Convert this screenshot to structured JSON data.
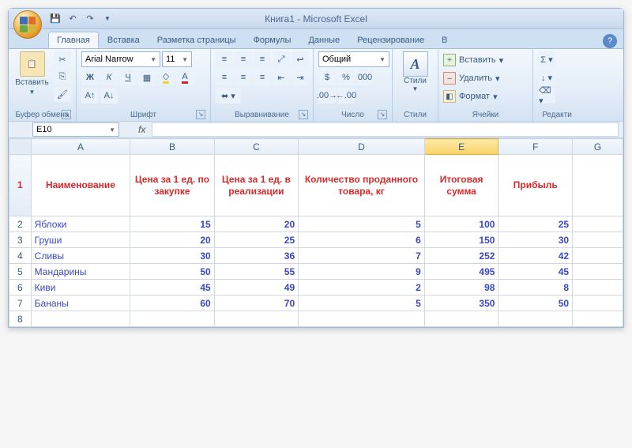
{
  "title": "Книга1 - Microsoft Excel",
  "qat": {
    "save": "💾",
    "undo": "↶",
    "redo": "↷"
  },
  "tabs": [
    "Главная",
    "Вставка",
    "Разметка страницы",
    "Формулы",
    "Данные",
    "Рецензирование",
    "В"
  ],
  "ribbon": {
    "clipboard": {
      "label": "Буфер обмена",
      "paste": "Вставить"
    },
    "font": {
      "label": "Шрифт",
      "name": "Arial Narrow",
      "size": "11"
    },
    "align": {
      "label": "Выравнивание"
    },
    "number": {
      "label": "Число",
      "format": "Общий"
    },
    "styles": {
      "label": "Стили",
      "btn": "Стили"
    },
    "cells": {
      "label": "Ячейки",
      "insert": "Вставить",
      "delete": "Удалить",
      "format": "Формат"
    },
    "edit": {
      "label": "Редакти"
    }
  },
  "namebox": "E10",
  "columns": [
    "A",
    "B",
    "C",
    "D",
    "E",
    "F",
    "G"
  ],
  "selectedCol": "E",
  "headers": {
    "A": "Наименование",
    "B": "Цена за 1 ед. по закупке",
    "C": "Цена за 1 ед. в реализации",
    "D": "Количество проданного товара, кг",
    "E": "Итоговая сумма",
    "F": "Прибыль"
  },
  "rows": [
    {
      "n": 2,
      "A": "Яблоки",
      "B": "15",
      "C": "20",
      "D": "5",
      "E": "100",
      "F": "25"
    },
    {
      "n": 3,
      "A": "Груши",
      "B": "20",
      "C": "25",
      "D": "6",
      "E": "150",
      "F": "30"
    },
    {
      "n": 4,
      "A": "Сливы",
      "B": "30",
      "C": "36",
      "D": "7",
      "E": "252",
      "F": "42"
    },
    {
      "n": 5,
      "A": "Мандарины",
      "B": "50",
      "C": "55",
      "D": "9",
      "E": "495",
      "F": "45"
    },
    {
      "n": 6,
      "A": "Киви",
      "B": "45",
      "C": "49",
      "D": "2",
      "E": "98",
      "F": "8"
    },
    {
      "n": 7,
      "A": "Бананы",
      "B": "60",
      "C": "70",
      "D": "5",
      "E": "350",
      "F": "50"
    }
  ]
}
